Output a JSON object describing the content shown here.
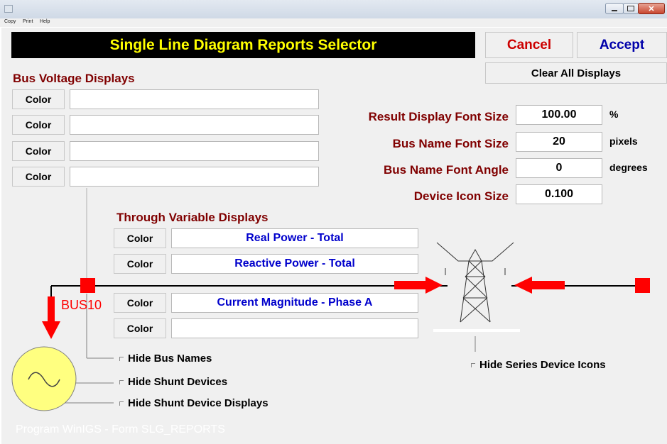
{
  "window": {
    "menu": [
      "Copy",
      "Print",
      "Help"
    ]
  },
  "header": {
    "title": "Single Line Diagram Reports Selector",
    "cancel_label": "Cancel",
    "accept_label": "Accept",
    "clear_label": "Clear All Displays"
  },
  "bus_voltage": {
    "title": "Bus Voltage Displays",
    "rows": [
      {
        "button": "Color",
        "value": ""
      },
      {
        "button": "Color",
        "value": ""
      },
      {
        "button": "Color",
        "value": ""
      },
      {
        "button": "Color",
        "value": ""
      }
    ]
  },
  "settings": {
    "result_font_size": {
      "label": "Result Display Font Size",
      "value": "100.00",
      "unit": "%"
    },
    "bus_name_font_size": {
      "label": "Bus Name Font Size",
      "value": "20",
      "unit": "pixels"
    },
    "bus_name_font_angle": {
      "label": "Bus Name Font Angle",
      "value": "0",
      "unit": "degrees"
    },
    "device_icon_size": {
      "label": "Device Icon Size",
      "value": "0.100",
      "unit": ""
    }
  },
  "through_variable": {
    "title": "Through Variable Displays",
    "rows": [
      {
        "button": "Color",
        "value": "Real Power - Total"
      },
      {
        "button": "Color",
        "value": "Reactive Power - Total"
      },
      {
        "button": "Color",
        "value": "Current Magnitude - Phase A"
      },
      {
        "button": "Color",
        "value": ""
      }
    ]
  },
  "diagram": {
    "bus_name": "BUS10"
  },
  "options": {
    "hide_bus_names": "Hide Bus Names",
    "hide_shunt_devices": "Hide Shunt Devices",
    "hide_shunt_displays": "Hide Shunt Device Displays",
    "hide_series_icons": "Hide Series Device Icons"
  },
  "footer": {
    "text": "Program WinIGS - Form SLG_REPORTS"
  },
  "colors": {
    "title_text": "#ffff00",
    "section_text": "#800000",
    "bus_red": "#ff0000",
    "generator_fill": "#ffff80"
  }
}
